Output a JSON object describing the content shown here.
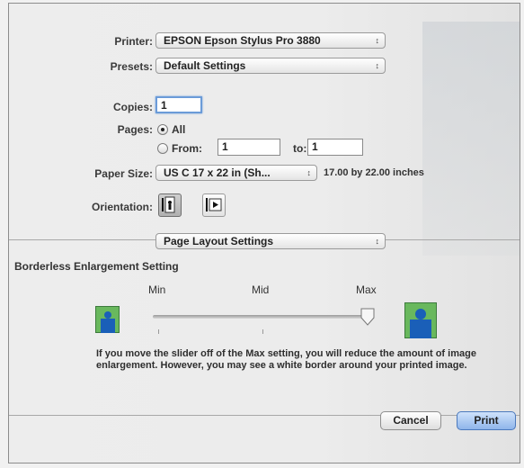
{
  "printer": {
    "label": "Printer:",
    "value": "EPSON Epson Stylus Pro 3880"
  },
  "presets": {
    "label": "Presets:",
    "value": "Default Settings"
  },
  "copies": {
    "label": "Copies:",
    "value": "1"
  },
  "pages": {
    "label": "Pages:",
    "all_label": "All",
    "from_label": "From:",
    "from_value": "1",
    "to_label": "to:",
    "to_value": "1",
    "selected": "All"
  },
  "paper_size": {
    "label": "Paper Size:",
    "value": "US C 17 x 22 in (Sh...",
    "dimensions": "17.00 by 22.00 inches"
  },
  "orientation": {
    "label": "Orientation:",
    "selected": "portrait"
  },
  "panel_select": {
    "value": "Page Layout Settings"
  },
  "borderless": {
    "title": "Borderless Enlargement Setting",
    "min_label": "Min",
    "mid_label": "Mid",
    "max_label": "Max",
    "slider_value": "Max",
    "note": "If you move the slider off of the Max setting, you will reduce the amount of image enlargement. However, you may see a white border around your printed image."
  },
  "buttons": {
    "cancel": "Cancel",
    "print": "Print"
  },
  "icons": {
    "popup_arrows": "up-down-arrows-icon",
    "portrait": "portrait-orientation-icon",
    "landscape": "landscape-orientation-icon",
    "small_image": "small-image-icon",
    "large_image": "large-image-icon"
  },
  "colors": {
    "accent": "#6b9bd8",
    "image_green": "#69b85d",
    "image_figure": "#1a5fb8"
  }
}
